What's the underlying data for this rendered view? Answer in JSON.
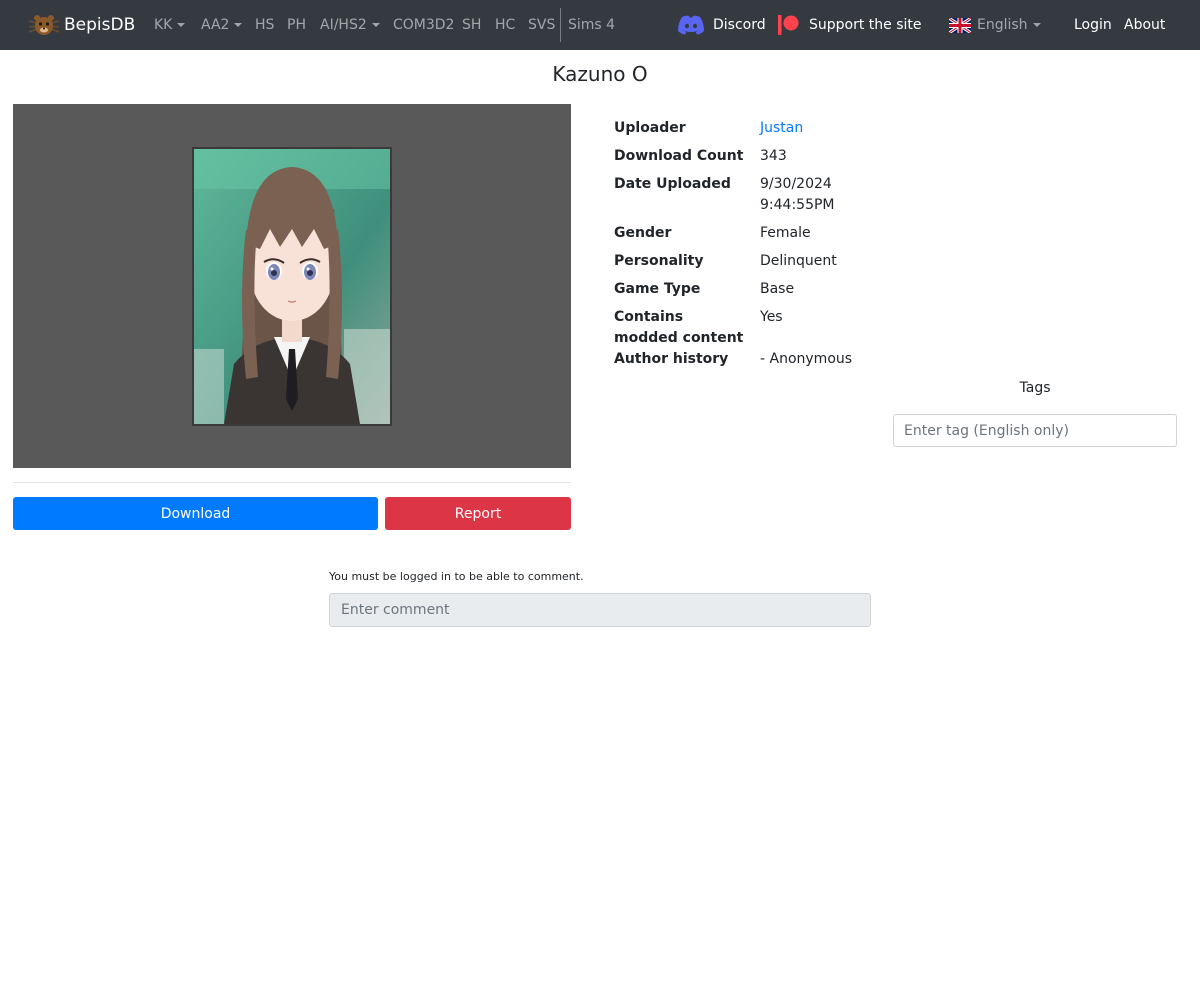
{
  "nav": {
    "brand": "BepisDB",
    "items": [
      {
        "label": "KK",
        "dropdown": true
      },
      {
        "label": "AA2",
        "dropdown": true
      },
      {
        "label": "HS",
        "dropdown": false
      },
      {
        "label": "PH",
        "dropdown": false
      },
      {
        "label": "AI/HS2",
        "dropdown": true
      },
      {
        "label": "COM3D2",
        "dropdown": false
      },
      {
        "label": "SH",
        "dropdown": false
      },
      {
        "label": "HC",
        "dropdown": false
      },
      {
        "label": "SVS",
        "dropdown": false
      },
      {
        "label": "Sims 4",
        "dropdown": false
      }
    ],
    "discord": "Discord",
    "support": "Support the site",
    "language": "English",
    "login": "Login",
    "about": "About"
  },
  "card": {
    "title": "Kazuno O"
  },
  "info": {
    "uploader_label": "Uploader",
    "uploader_value": "Justan",
    "download_count_label": "Download Count",
    "download_count_value": "343",
    "date_uploaded_label": "Date Uploaded",
    "date_value": "9/30/2024",
    "time_value": "9:44:55PM",
    "gender_label": "Gender",
    "gender_value": "Female",
    "personality_label": "Personality",
    "personality_value": "Delinquent",
    "game_type_label": "Game Type",
    "game_type_value": "Base",
    "modded_label_line1": "Contains",
    "modded_label_line2": "modded content",
    "modded_value": "Yes",
    "author_history_label": "Author history",
    "author_history_value": "- Anonymous"
  },
  "actions": {
    "download": "Download",
    "report": "Report"
  },
  "tags": {
    "label": "Tags",
    "placeholder": "Enter tag (English only)"
  },
  "comments": {
    "note": "You must be logged in to be able to comment.",
    "placeholder": "Enter comment"
  },
  "colors": {
    "navbar": "#343a40",
    "primary": "#007bff",
    "danger": "#dc3545",
    "preview_bg": "#595959",
    "patreon": "#ff424d",
    "discord": "#5865f2"
  }
}
